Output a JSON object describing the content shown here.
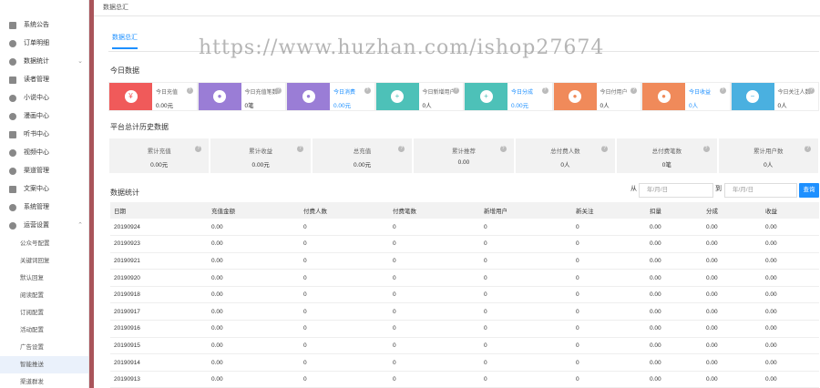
{
  "sidebar": {
    "items": [
      {
        "label": "系统公告",
        "icon": "speaker-icon"
      },
      {
        "label": "订单明细",
        "icon": "order-icon"
      },
      {
        "label": "数据统计",
        "icon": "stats-icon",
        "chevron": "⌄"
      },
      {
        "label": "读者管理",
        "icon": "reader-icon"
      },
      {
        "label": "小说中心",
        "icon": "novel-icon"
      },
      {
        "label": "漫画中心",
        "icon": "comic-icon"
      },
      {
        "label": "听书中心",
        "icon": "audio-icon"
      },
      {
        "label": "视频中心",
        "icon": "video-icon"
      },
      {
        "label": "渠道管理",
        "icon": "channel-icon"
      },
      {
        "label": "文案中心",
        "icon": "copy-icon"
      },
      {
        "label": "系统管理",
        "icon": "settings-icon"
      },
      {
        "label": "运营设置",
        "icon": "ops-icon",
        "chevron": "⌃"
      }
    ],
    "sub_items": [
      "公众号配置",
      "关键词回复",
      "默认回复",
      "阅读配置",
      "订阅配置",
      "活动配置",
      "广告设置",
      "智能推送",
      "渠道群发"
    ],
    "active_sub": 7
  },
  "topbar": {
    "title": "数据总汇"
  },
  "tab": {
    "label": "数据总汇"
  },
  "watermark": "https://www.huzhan.com/ishop27674",
  "today": {
    "title": "今日数据",
    "cards": [
      {
        "label": "今日充值",
        "value": "0.00元",
        "color": "#f05a5a",
        "glyph": "¥",
        "blue": false
      },
      {
        "label": "今日充值笔数",
        "value": "0笔",
        "color": "#9a7dd6",
        "glyph": "●",
        "blue": false
      },
      {
        "label": "今日消费",
        "value": "0.00元",
        "color": "#9a7dd6",
        "glyph": "●",
        "blue": true
      },
      {
        "label": "今日新增用户",
        "value": "0人",
        "color": "#4dc1b8",
        "glyph": "+",
        "blue": false
      },
      {
        "label": "今日分成",
        "value": "0.00元",
        "color": "#4dc1b8",
        "glyph": "+",
        "blue": true
      },
      {
        "label": "今日付用户",
        "value": "0人",
        "color": "#f08a5a",
        "glyph": "●",
        "blue": false
      },
      {
        "label": "今日收益",
        "value": "0人",
        "color": "#f08a5a",
        "glyph": "●",
        "blue": true
      },
      {
        "label": "今日关注人数",
        "value": "0人",
        "color": "#4ab0e0",
        "glyph": "−",
        "blue": false
      }
    ]
  },
  "overall": {
    "title": "平台总计历史数据",
    "stats": [
      {
        "label": "累计充值",
        "value": "0.00元"
      },
      {
        "label": "累计收益",
        "value": "0.00元"
      },
      {
        "label": "总充值",
        "value": "0.00元"
      },
      {
        "label": "累计推荐",
        "value": "0.00"
      },
      {
        "label": "总付费人数",
        "value": "0人"
      },
      {
        "label": "总付费笔数",
        "value": "0笔"
      },
      {
        "label": "累计用户数",
        "value": "0人"
      }
    ]
  },
  "detail": {
    "title": "数据统计",
    "from_label": "从",
    "to_label": "到",
    "date_placeholder": "年/月/日",
    "query_label": "查询",
    "columns": [
      "日期",
      "充值金额",
      "付费人数",
      "付费笔数",
      "新增用户",
      "新关注",
      "扣量",
      "分成",
      "收益"
    ],
    "rows": [
      [
        "20190924",
        "0.00",
        "0",
        "0",
        "0",
        "0",
        "0.00",
        "0.00",
        "0.00"
      ],
      [
        "20190923",
        "0.00",
        "0",
        "0",
        "0",
        "0",
        "0.00",
        "0.00",
        "0.00"
      ],
      [
        "20190921",
        "0.00",
        "0",
        "0",
        "0",
        "0",
        "0.00",
        "0.00",
        "0.00"
      ],
      [
        "20190920",
        "0.00",
        "0",
        "0",
        "0",
        "0",
        "0.00",
        "0.00",
        "0.00"
      ],
      [
        "20190918",
        "0.00",
        "0",
        "0",
        "0",
        "0",
        "0.00",
        "0.00",
        "0.00"
      ],
      [
        "20190917",
        "0.00",
        "0",
        "0",
        "0",
        "0",
        "0.00",
        "0.00",
        "0.00"
      ],
      [
        "20190916",
        "0.00",
        "0",
        "0",
        "0",
        "0",
        "0.00",
        "0.00",
        "0.00"
      ],
      [
        "20190915",
        "0.00",
        "0",
        "0",
        "0",
        "0",
        "0.00",
        "0.00",
        "0.00"
      ],
      [
        "20190914",
        "0.00",
        "0",
        "0",
        "0",
        "0",
        "0.00",
        "0.00",
        "0.00"
      ],
      [
        "20190913",
        "0.00",
        "0",
        "0",
        "0",
        "0",
        "0.00",
        "0.00",
        "0.00"
      ]
    ]
  }
}
